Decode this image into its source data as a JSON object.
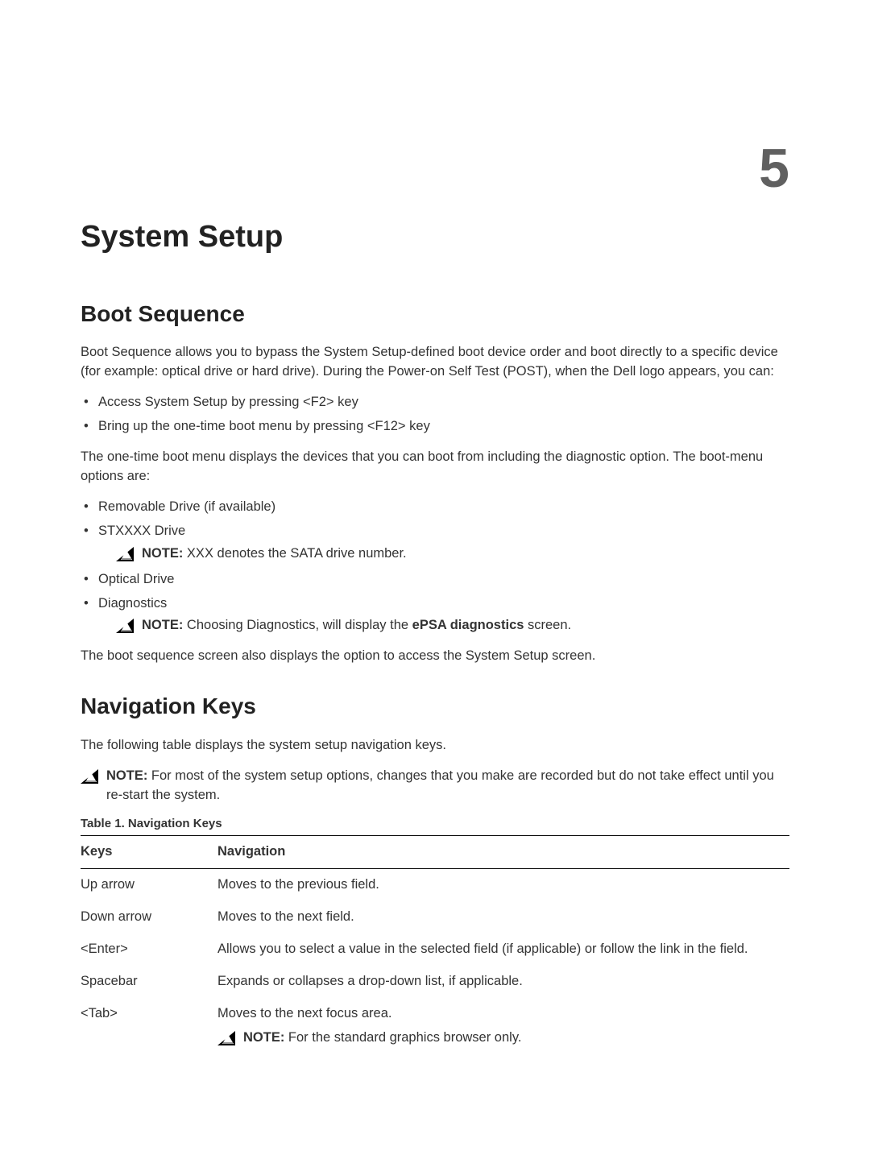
{
  "chapter": {
    "number": "5",
    "title": "System Setup"
  },
  "section1": {
    "title": "Boot Sequence",
    "intro": "Boot Sequence allows you to bypass the System Setup-defined boot device order and boot directly to a specific device (for example: optical drive or hard drive). During the Power-on Self Test (POST), when the Dell logo appears, you can:",
    "access_list": [
      "Access System Setup by pressing <F2> key",
      "Bring up the one-time boot menu by pressing <F12> key"
    ],
    "para2": "The one-time boot menu displays the devices that you can boot from including the diagnostic option. The boot-menu options are:",
    "options": {
      "item1": "Removable Drive (if available)",
      "item2": "STXXXX Drive",
      "note1_label": "NOTE:",
      "note1_text": " XXX denotes the SATA drive number.",
      "item3": "Optical Drive",
      "item4": "Diagnostics",
      "note2_label": "NOTE:",
      "note2_text_a": " Choosing Diagnostics, will display the ",
      "note2_bold": "ePSA diagnostics",
      "note2_text_b": " screen."
    },
    "para3": "The boot sequence screen also displays the option to access the System Setup screen."
  },
  "section2": {
    "title": "Navigation Keys",
    "intro": "The following table displays the system setup navigation keys.",
    "note_label": "NOTE:",
    "note_text": " For most of the system setup options, changes that you make are recorded but do not take effect until you re-start the system.",
    "table_caption": "Table 1. Navigation Keys",
    "table": {
      "head_keys": "Keys",
      "head_nav": "Navigation",
      "rows": [
        {
          "key": "Up arrow",
          "nav": "Moves to the previous field."
        },
        {
          "key": "Down arrow",
          "nav": "Moves to the next field."
        },
        {
          "key": "<Enter>",
          "nav": "Allows you to select a value in the selected field (if applicable) or follow the link in the field."
        },
        {
          "key": "Spacebar",
          "nav": "Expands or collapses a drop-down list, if applicable."
        },
        {
          "key": "<Tab>",
          "nav": "Moves to the next focus area.",
          "note_label": "NOTE:",
          "note_text": " For the standard graphics browser only."
        }
      ]
    }
  }
}
